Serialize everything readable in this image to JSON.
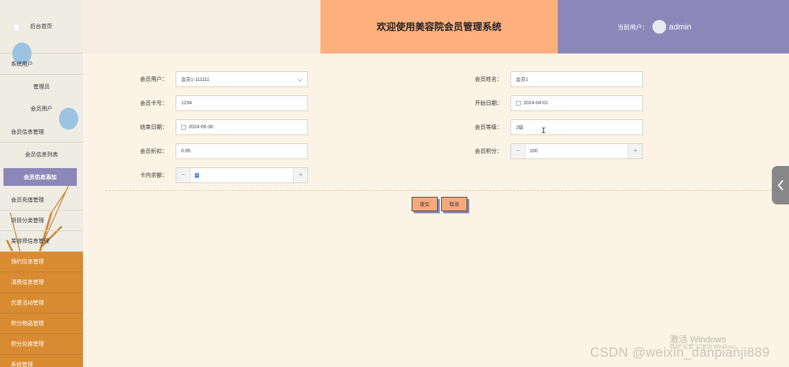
{
  "sidebar": {
    "home": "后台首页",
    "system_users": "系统用户",
    "admin": "管理员",
    "member_user": "会员用户",
    "member_info_mgmt": "会员信息管理",
    "member_info_list": "会员信息列表",
    "member_info_add": "会员信息添加",
    "member_recharge_mgmt": "会员充值管理",
    "project_category_mgmt": "项目分类管理",
    "beautician_mgmt": "美容师信息管理",
    "appointment_mgmt": "预约信息管理",
    "consumption_mgmt": "消费信息管理",
    "promotion_mgmt": "优惠活动管理",
    "points_goods_mgmt": "积分物品管理",
    "points_exchange_mgmt": "积分兑换管理",
    "system_mgmt": "系统管理"
  },
  "header": {
    "title": "欢迎使用美容院会员管理系统",
    "current_user_label": "当前用户：",
    "username": "admin"
  },
  "form": {
    "member_user_label": "会员用户：",
    "member_user_value": "会员1-111111",
    "member_name_label": "会员姓名：",
    "member_name_value": "会员1",
    "card_no_label": "会员卡号：",
    "card_no_value": "1234",
    "start_date_label": "开始日期：",
    "start_date_value": "2024-04-01",
    "end_date_label": "结束日期：",
    "end_date_value": "2024-06-30",
    "level_label": "会员等级：",
    "level_value": "2级",
    "discount_label": "会员折扣：",
    "discount_value": "0.95",
    "points_label": "会员积分：",
    "points_value": "100",
    "balance_label": "卡内余额：",
    "balance_value": "0",
    "minus": "−",
    "plus": "+"
  },
  "actions": {
    "submit": "提交",
    "cancel": "取消"
  },
  "watermark": {
    "windows": "激活 Windows",
    "windows_sub": "转到\"设置\"以激活 Windows。",
    "csdn": "CSDN @weixin_danpianji889"
  },
  "colors": {
    "accent_orange": "#fdb07e",
    "accent_purple": "#8b88b9",
    "sidebar_orange": "#d98b32"
  }
}
